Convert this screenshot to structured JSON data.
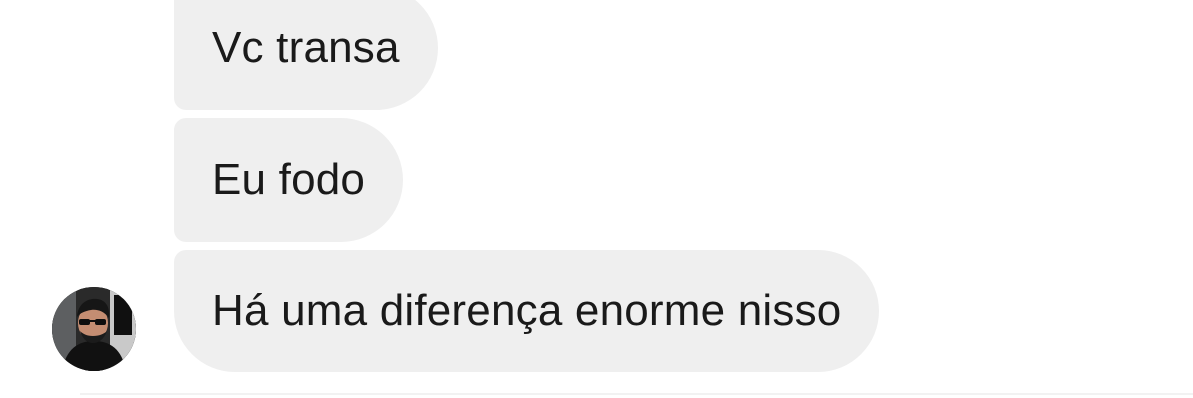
{
  "conversation": {
    "messages": [
      {
        "text": "Vc transa"
      },
      {
        "text": "Eu fodo"
      },
      {
        "text": "Há uma diferença enorme nisso"
      }
    ],
    "sender": {
      "avatar_icon": "user-photo-avatar"
    }
  },
  "colors": {
    "page_background": "#ffffff",
    "bubble_background": "#efefef",
    "message_text": "#1a1a1a"
  }
}
